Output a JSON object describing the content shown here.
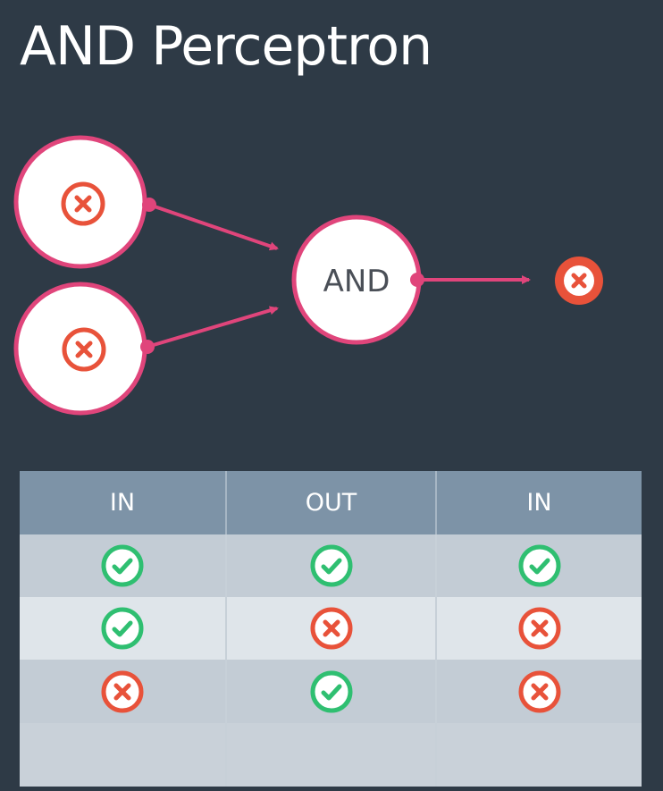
{
  "title": "AND Perceptron",
  "colors": {
    "background": "#2e3a46",
    "accent": "#e0457b",
    "false_red": "#e8523a",
    "true_green": "#2fbf71"
  },
  "diagram": {
    "inputs": [
      {
        "icon": "x-circle-icon",
        "value": "false"
      },
      {
        "icon": "x-circle-icon",
        "value": "false"
      }
    ],
    "node_label": "AND",
    "output": {
      "icon": "x-circle-icon",
      "value": "false"
    }
  },
  "table": {
    "headers": [
      "IN",
      "OUT",
      "IN"
    ],
    "rows": [
      [
        "check",
        "check",
        "check"
      ],
      [
        "check",
        "cross",
        "cross"
      ],
      [
        "cross",
        "check",
        "cross"
      ],
      [
        "",
        "",
        ""
      ]
    ]
  }
}
